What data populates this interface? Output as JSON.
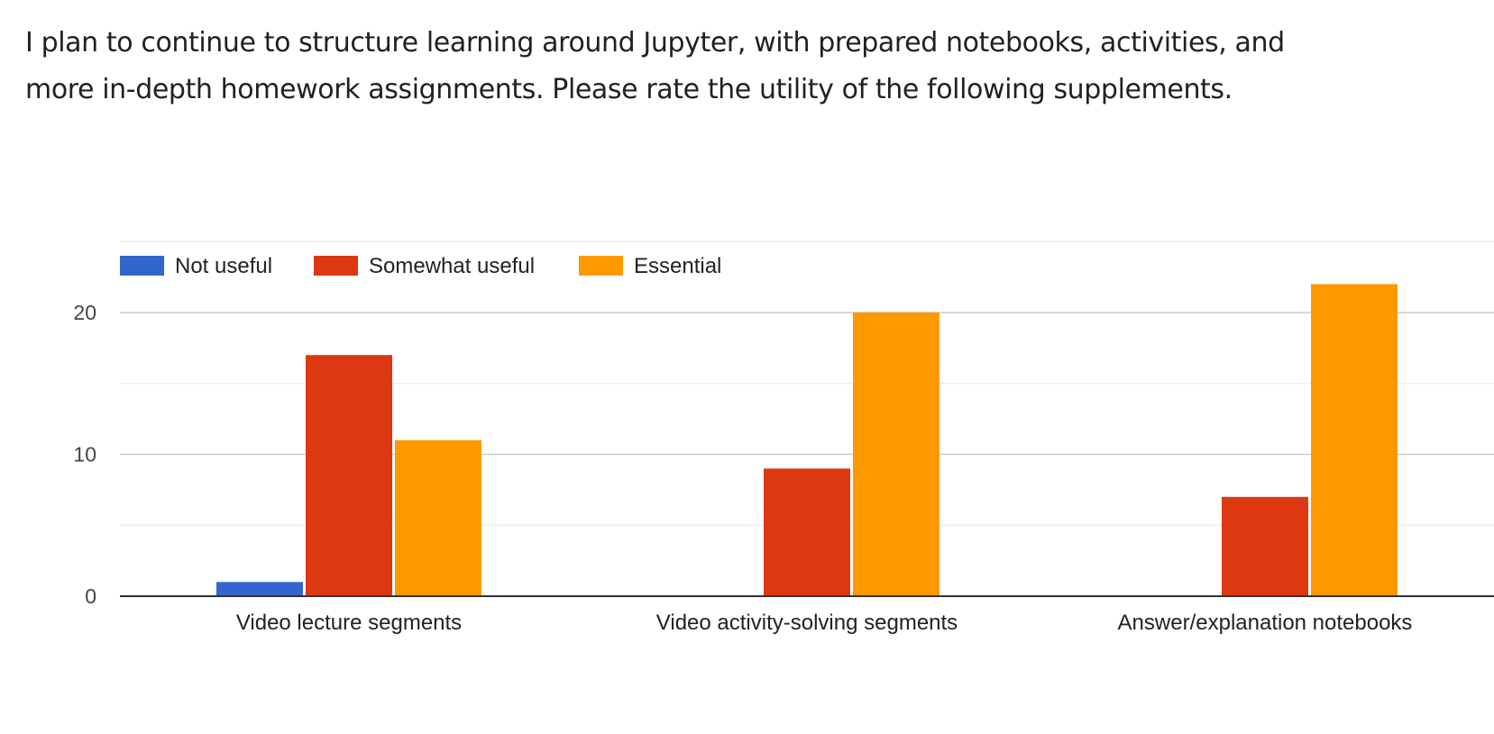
{
  "question": {
    "text": "I plan to continue to structure learning around Jupyter, with prepared notebooks, activities, and more in-depth homework assignments. Please rate the utility of the following supplements."
  },
  "chart_data": {
    "type": "bar",
    "title": "",
    "xlabel": "",
    "ylabel": "",
    "categories": [
      "Video lecture segments",
      "Video activity-solving segments",
      "Answer/explanation notebooks"
    ],
    "series": [
      {
        "name": "Not useful",
        "color": "#3366cc",
        "values": [
          1,
          0,
          0
        ]
      },
      {
        "name": "Somewhat useful",
        "color": "#dc3912",
        "values": [
          17,
          9,
          7
        ]
      },
      {
        "name": "Essential",
        "color": "#ff9900",
        "values": [
          11,
          20,
          22
        ]
      }
    ],
    "ylim": [
      0,
      25
    ],
    "yticks": [
      0,
      10,
      20
    ],
    "grid": true,
    "legend_position": "top-left"
  }
}
